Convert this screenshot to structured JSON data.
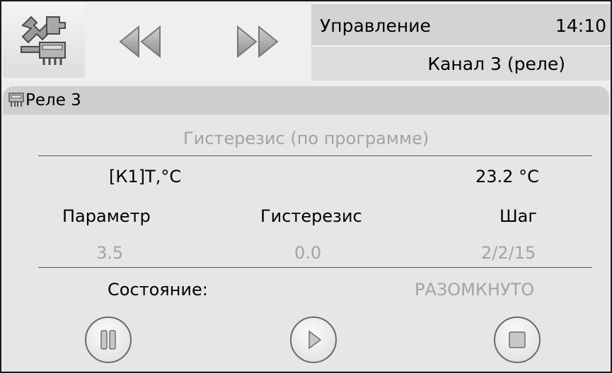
{
  "header": {
    "mode_label": "Управление",
    "clock": "14:10",
    "channel_label": "Канал 3 (реле)",
    "icons": [
      "tools-icon",
      "rewind-icon",
      "fast-forward-icon"
    ]
  },
  "panel": {
    "title": "Реле 3",
    "icon": "relay-icon",
    "mode": "Гистерезис (по программе)",
    "input_label": "[К1]Т,°С",
    "input_value": "23.2 °С",
    "columns": {
      "parameter": "Параметр",
      "hysteresis": "Гистерезис",
      "step": "Шаг"
    },
    "values": {
      "parameter": "3.5",
      "hysteresis": "0.0",
      "step": "2/2/15"
    },
    "state_label": "Состояние:",
    "state_value": "РАЗОМКНУТО"
  },
  "controls": [
    "pause-icon",
    "play-icon",
    "stop-icon"
  ],
  "colors": {
    "background": "#ededed",
    "header_bar": "#d3d3d3",
    "disabled_text": "#a3a3a3"
  }
}
